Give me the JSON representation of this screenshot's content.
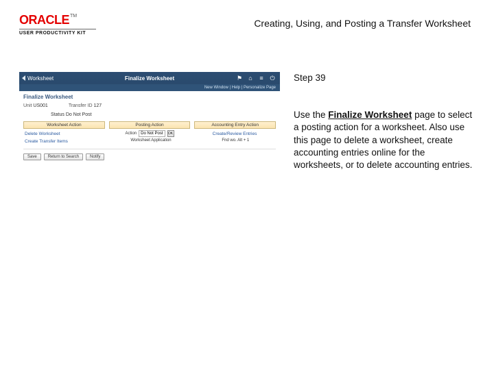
{
  "logo": {
    "brand": "ORACLE",
    "tm": "TM",
    "sub": "USER PRODUCTIVITY KIT"
  },
  "doc": {
    "title": "Creating, Using, and Posting a Transfer Worksheet",
    "step": "Step 39",
    "body_pre": "Use the ",
    "body_bold": "Finalize Worksheet",
    "body_post": " page to select a posting action for a worksheet. Also use this page to delete a worksheet, create accounting entries online for the worksheets, or to delete accounting entries."
  },
  "app": {
    "back_label": "Worksheet",
    "page_title": "Finalize Worksheet",
    "icons": {
      "flag": "⚑",
      "home": "⌂",
      "menu": "≡",
      "power": "⏻"
    },
    "substrip": "New Window | Help | Personalize Page",
    "heading": "Finalize Worksheet",
    "meta": {
      "unit_label": "Unit",
      "unit_value": "US001",
      "transfer_label": "Transfer ID",
      "transfer_value": "127"
    },
    "status_label": "Status",
    "status_value": "Do Not Post",
    "cols": {
      "a": "Worksheet Action",
      "b": "Posting Action",
      "c": "Accounting Entry Action"
    },
    "row2": {
      "link": "Delete Worksheet",
      "select_label": "Action",
      "select_value": "Do Not Post",
      "ok": "OK",
      "right_link": "Create/Review Entries"
    },
    "row3": {
      "link": "Create Transfer Items",
      "mid": "Worksheet Application",
      "right": "Fnd wo. Alt + 1"
    },
    "footer": {
      "save": "Save",
      "return": "Return to Search",
      "notify": "Notify"
    }
  }
}
